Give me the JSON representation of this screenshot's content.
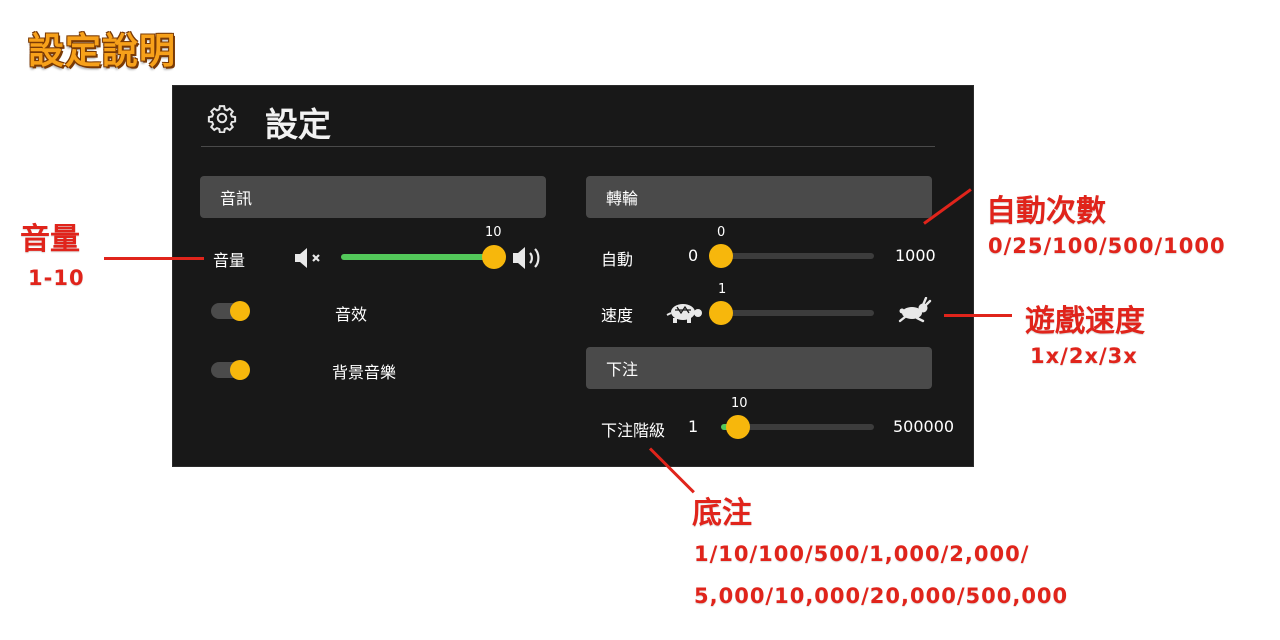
{
  "page_title": "設定說明",
  "panel": {
    "title": "設定",
    "audio": {
      "section_label": "音訊",
      "volume_label": "音量",
      "volume_value": "10",
      "volume_fraction": 1.0,
      "sfx_label": "音效",
      "bgm_label": "背景音樂"
    },
    "spin": {
      "section_label": "轉輪",
      "auto_label": "自動",
      "auto_min": "0",
      "auto_value": "0",
      "auto_max": "1000",
      "speed_label": "速度",
      "speed_value": "1"
    },
    "bet": {
      "section_label": "下注",
      "level_label": "下注階級",
      "level_min": "1",
      "level_value": "10",
      "level_max": "500000"
    }
  },
  "annotations": {
    "volume_title": "音量",
    "volume_range": "1-10",
    "auto_title": "自動次數",
    "auto_options": "0/25/100/500/1000",
    "speed_title": "遊戲速度",
    "speed_options": "1x/2x/3x",
    "bet_title": "底注",
    "bet_options_line1": "1/10/100/500/1,000/2,000/",
    "bet_options_line2": "5,000/10,000/20,000/500,000"
  },
  "icons": {
    "gear": "gear-icon",
    "mute": "speaker-mute-icon",
    "loud": "speaker-loud-icon",
    "turtle": "turtle-icon",
    "rabbit": "rabbit-icon"
  },
  "colors": {
    "accent_knob": "#f7b70c",
    "slider_fill": "#53c85a",
    "annotation_red": "#e0241b",
    "title_orange": "#f7a11a"
  }
}
